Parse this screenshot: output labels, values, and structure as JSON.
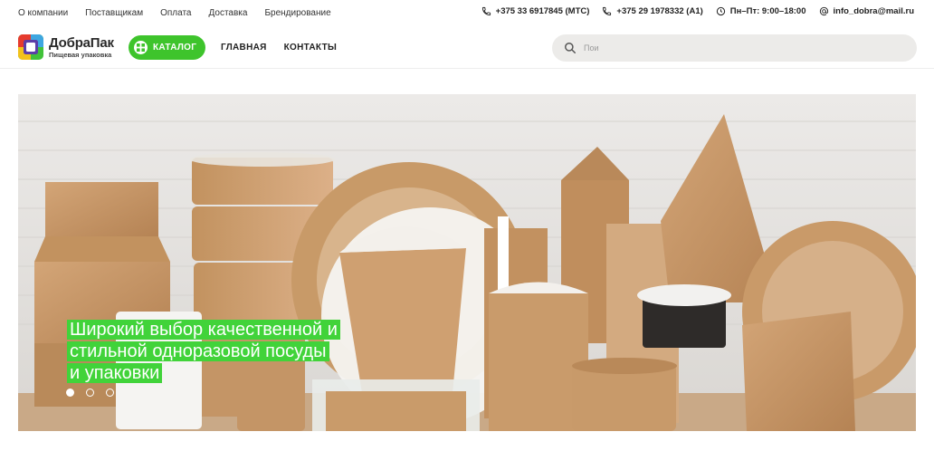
{
  "top_nav": [
    {
      "label": "О компании"
    },
    {
      "label": "Поставщикам"
    },
    {
      "label": "Оплата"
    },
    {
      "label": "Доставка"
    },
    {
      "label": "Брендирование"
    }
  ],
  "contacts": {
    "phone_mts": "+375 33 6917845 (МТС)",
    "phone_a1": "+375 29 1978332 (А1)",
    "hours": "Пн–Пт: 9:00–18:00",
    "email": "info_dobra@mail.ru"
  },
  "logo": {
    "name": "ДобраПак",
    "subtitle": "Пищевая упаковка",
    "colors": [
      "#f2c21b",
      "#e63b2e",
      "#5b3ea8",
      "#3ea6e0",
      "#41c23a"
    ]
  },
  "header": {
    "catalog_label": "КАТАЛОГ",
    "nav": [
      {
        "label": "ГЛАВНАЯ"
      },
      {
        "label": "КОНТАКТЫ"
      }
    ],
    "search_placeholder": "Пои"
  },
  "banner": {
    "slogan_lines": [
      "Широкий выбор качественной и",
      "стильной одноразовой посуды",
      "и упаковки"
    ],
    "slides_total": 3,
    "active_slide": 1
  },
  "colors": {
    "accent_green": "#3ec42c",
    "slogan_bg": "#41d33a",
    "search_bg": "#ecebe9"
  }
}
